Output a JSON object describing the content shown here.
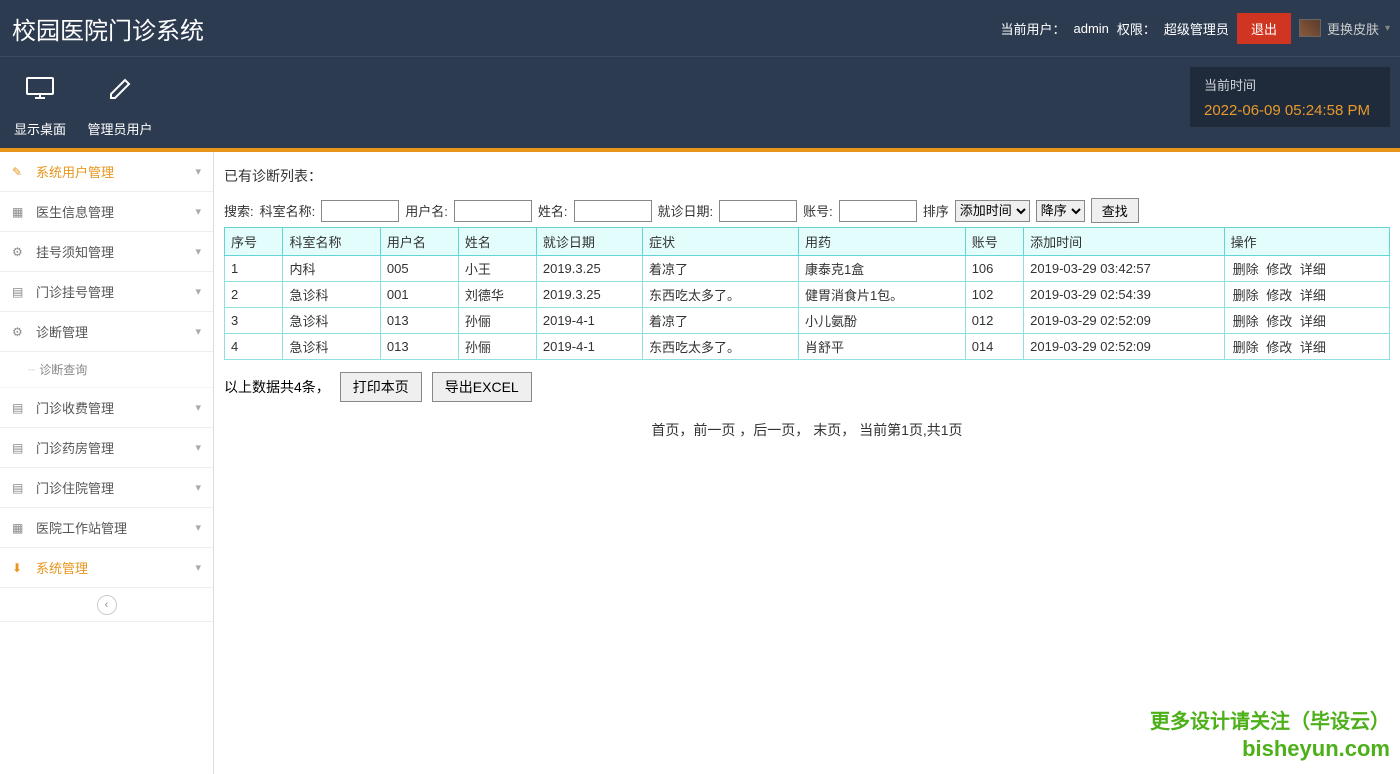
{
  "header": {
    "app_title": "校园医院门诊系统",
    "current_user_label": "当前用户：",
    "current_user": "admin",
    "role_label": "权限：",
    "role": "超级管理员",
    "logout": "退出",
    "skin_label": "更换皮肤"
  },
  "toolbar": {
    "items": [
      {
        "label": "显示桌面",
        "icon": "monitor"
      },
      {
        "label": "管理员用户",
        "icon": "pencil"
      }
    ],
    "time_label": "当前时间",
    "time_value": "2022-06-09 05:24:58 PM"
  },
  "sidebar": {
    "items": [
      {
        "label": "系统用户管理",
        "icon": "✎",
        "active": true
      },
      {
        "label": "医生信息管理",
        "icon": "▦",
        "active": false
      },
      {
        "label": "挂号须知管理",
        "icon": "⚙",
        "active": false
      },
      {
        "label": "门诊挂号管理",
        "icon": "▤",
        "active": false
      },
      {
        "label": "诊断管理",
        "icon": "⚙",
        "active": false,
        "submenu": [
          {
            "label": "诊断查询"
          }
        ]
      },
      {
        "label": "门诊收费管理",
        "icon": "▤",
        "active": false
      },
      {
        "label": "门诊药房管理",
        "icon": "▤",
        "active": false
      },
      {
        "label": "门诊住院管理",
        "icon": "▤",
        "active": false
      },
      {
        "label": "医院工作站管理",
        "icon": "▦",
        "active": false
      },
      {
        "label": "系统管理",
        "icon": "⬇",
        "active": true
      }
    ]
  },
  "content": {
    "list_title": "已有诊断列表：",
    "search": {
      "prefix": "搜索:",
      "dept_label": "科室名称:",
      "user_label": "用户名:",
      "name_label": "姓名:",
      "date_label": "就诊日期:",
      "acct_label": "账号:",
      "sort_label": "排序",
      "sort_field_options": [
        "添加时间"
      ],
      "sort_field_selected": "添加时间",
      "sort_dir_options": [
        "降序"
      ],
      "sort_dir_selected": "降序",
      "search_btn": "查找"
    },
    "table": {
      "headers": [
        "序号",
        "科室名称",
        "用户名",
        "姓名",
        "就诊日期",
        "症状",
        "用药",
        "账号",
        "添加时间",
        "操作"
      ],
      "rows": [
        {
          "idx": "1",
          "dept": "内科",
          "user": "005",
          "name": "小王",
          "date": "2019.3.25",
          "sym": "着凉了",
          "med": "康泰克1盒",
          "acct": "106",
          "time": "2019-03-29 03:42:57"
        },
        {
          "idx": "2",
          "dept": "急诊科",
          "user": "001",
          "name": "刘德华",
          "date": "2019.3.25",
          "sym": "东西吃太多了。",
          "med": "健胃消食片1包。",
          "acct": "102",
          "time": "2019-03-29 02:54:39"
        },
        {
          "idx": "3",
          "dept": "急诊科",
          "user": "013",
          "name": "孙俪",
          "date": "2019-4-1",
          "sym": "着凉了",
          "med": "小儿氨酚",
          "acct": "012",
          "time": "2019-03-29 02:52:09"
        },
        {
          "idx": "4",
          "dept": "急诊科",
          "user": "013",
          "name": "孙俪",
          "date": "2019-4-1",
          "sym": "东西吃太多了。",
          "med": "肖舒平",
          "acct": "014",
          "time": "2019-03-29 02:52:09"
        }
      ],
      "ops": {
        "delete": "删除",
        "edit": "修改",
        "detail": "详细"
      }
    },
    "below": {
      "count_text": "以上数据共4条，",
      "print_btn": "打印本页",
      "export_btn": "导出EXCEL"
    },
    "pager_text": "首页，前一页 ，后一页， 末页， 当前第1页,共1页"
  },
  "watermark": {
    "line1": "更多设计请关注（毕设云）",
    "line2": "bisheyun.com"
  }
}
